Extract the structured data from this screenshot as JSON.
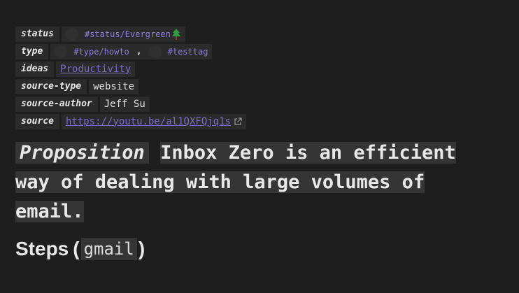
{
  "properties": {
    "status": {
      "key": "status",
      "tag": "#status/Evergreen"
    },
    "type": {
      "key": "type",
      "tag1": "#type/howto",
      "separator": ",",
      "tag2": "#testtag"
    },
    "ideas": {
      "key": "ideas",
      "value": "Productivity"
    },
    "source_type": {
      "key": "source-type",
      "value": "website"
    },
    "source_author": {
      "key": "source-author",
      "value": "Jeff Su"
    },
    "source": {
      "key": "source",
      "value": "https://youtu.be/al1QXFQjq1s"
    }
  },
  "proposition": {
    "label": "Proposition",
    "text": "Inbox Zero is an efficient way of dealing with large volumes of email."
  },
  "steps": {
    "heading": "Steps",
    "open_paren": "(",
    "code": "gmail",
    "close_paren": ")"
  },
  "colors": {
    "background": "#1e1e1e",
    "tag": "#8e7ee0",
    "link": "#7b6cc8",
    "highlight": "#353535"
  }
}
